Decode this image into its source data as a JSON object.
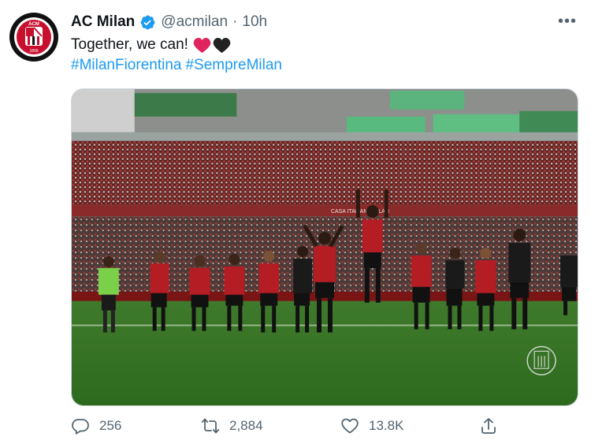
{
  "tweet": {
    "author_name": "AC Milan",
    "handle": "@acmilan",
    "separator": "·",
    "time": "10h",
    "text": "Together, we can!",
    "hashtags": [
      "#MilanFiorentina",
      "#SempreMilan"
    ],
    "more_label": "•••"
  },
  "avatar": {
    "logo_text_top": "ACM",
    "logo_year": "1899"
  },
  "media": {
    "description_icon": "stadium-photo",
    "banner_text": "CASA ITALIANA MILAN"
  },
  "actions": {
    "replies": "256",
    "retweets": "2,884",
    "likes": "13.8K"
  },
  "colors": {
    "link": "#1d9bf0",
    "verified": "#1d9bf0",
    "muted": "#536471",
    "heart_red": "#e0245e",
    "heart_black": "#222222"
  }
}
